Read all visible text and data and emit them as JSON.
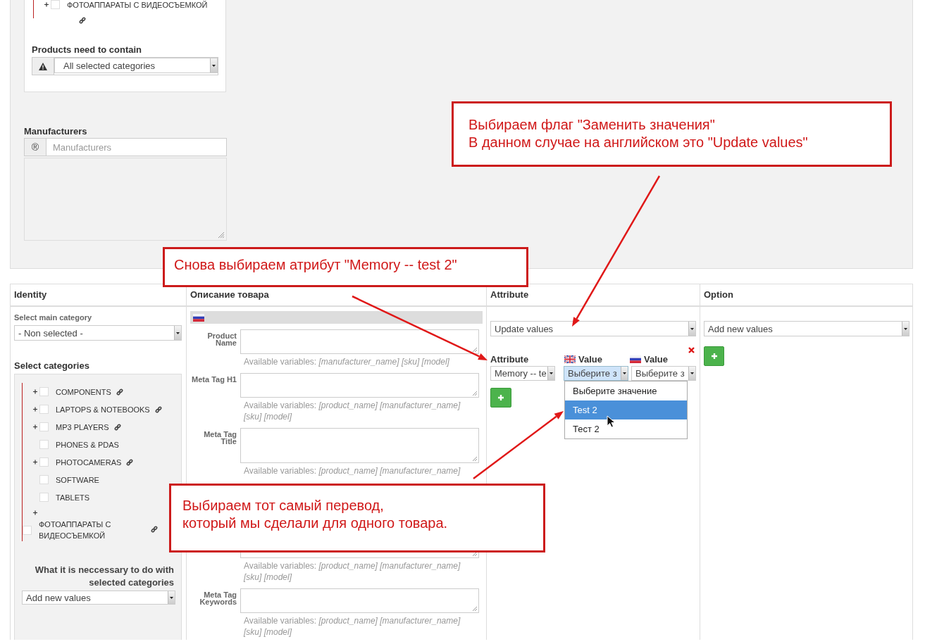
{
  "filter_panel": {
    "tree_tail": {
      "label": "ФОТОАППАРАТЫ С ВИДЕОСЪЕМКОЙ",
      "expandable": true,
      "checked": false,
      "linked": true
    },
    "contain": {
      "label": "Products need to contain",
      "value": "All selected categories"
    },
    "manufacturers": {
      "label": "Manufacturers",
      "addon": "®",
      "placeholder": "Manufacturers"
    }
  },
  "table": {
    "columns": [
      "Identity",
      "Описание товара",
      "Attribute",
      "Option"
    ],
    "identity": {
      "main_category_label": "Select main category",
      "main_category_value": "- Non selected -",
      "categories_label": "Select categories",
      "categories": [
        {
          "label": "COMPONENTS",
          "expandable": true,
          "checked": false,
          "linked": true
        },
        {
          "label": "LAPTOPS & NOTEBOOKS",
          "expandable": true,
          "checked": false,
          "linked": true
        },
        {
          "label": "MP3 PLAYERS",
          "expandable": true,
          "checked": false,
          "linked": true
        },
        {
          "label": "PHONES & PDAS",
          "expandable": false,
          "checked": false,
          "linked": false
        },
        {
          "label": "PHOTOCAMERAS",
          "expandable": true,
          "checked": false,
          "linked": true
        },
        {
          "label": "SOFTWARE",
          "expandable": false,
          "checked": false,
          "linked": false
        },
        {
          "label": "TABLETS",
          "expandable": false,
          "checked": false,
          "linked": false
        },
        {
          "label": "ФОТОАППАРАТЫ С ВИДЕОСЪЕМКОЙ",
          "expandable": true,
          "checked": false,
          "linked": true
        }
      ],
      "action_label": "What it is neccessary to do with selected categories",
      "action_value": "Add new values"
    },
    "description": {
      "fields": [
        {
          "kind": "short",
          "label": "Product Name",
          "hint": "Available variables: *[manufacturer_name] [sku] [model]*"
        },
        {
          "kind": "short",
          "label": "Meta Tag H1",
          "hint": "Available variables: *[product_name] [manufacturer_name] [sku] [model]*"
        },
        {
          "kind": "tall",
          "label": "Meta Tag Title",
          "hint": "Available variables: *[product_name] [manufacturer_name]*"
        },
        {
          "kind": "covered",
          "hint": "Available variables: *[product_name] [manufacturer_name] [sku] [model]*"
        },
        {
          "kind": "short",
          "label": "Meta Tag Keywords",
          "hint": "Available variables: *[product_name] [manufacturer_name] [sku] [model]*"
        }
      ]
    },
    "attribute": {
      "mode": "Update values",
      "headers": [
        "Attribute",
        "Value",
        "Value"
      ],
      "row": [
        {
          "kind": "attribute",
          "value": "Memory -- te",
          "focused": false
        },
        {
          "kind": "value-en",
          "value": "Выберите з",
          "focused": true
        },
        {
          "kind": "value-ru",
          "value": "Выберите з",
          "focused": false
        }
      ],
      "options": [
        {
          "label": "Выберите значение",
          "selected": false
        },
        {
          "label": "Test 2",
          "selected": true
        },
        {
          "label": "Тест 2",
          "selected": false
        }
      ]
    },
    "option": {
      "mode": "Add new values"
    }
  },
  "callouts": [
    {
      "lines": [
        "Выбираем флаг \"Заменить значения\"",
        "В данном случае на английском это \"Update values\""
      ]
    },
    {
      "lines": [
        "Снова выбираем атрибут \"Memory -- test 2\""
      ]
    },
    {
      "lines": [
        "Выбираем тот самый перевод,",
        "который мы сделали для одного товара."
      ]
    }
  ]
}
